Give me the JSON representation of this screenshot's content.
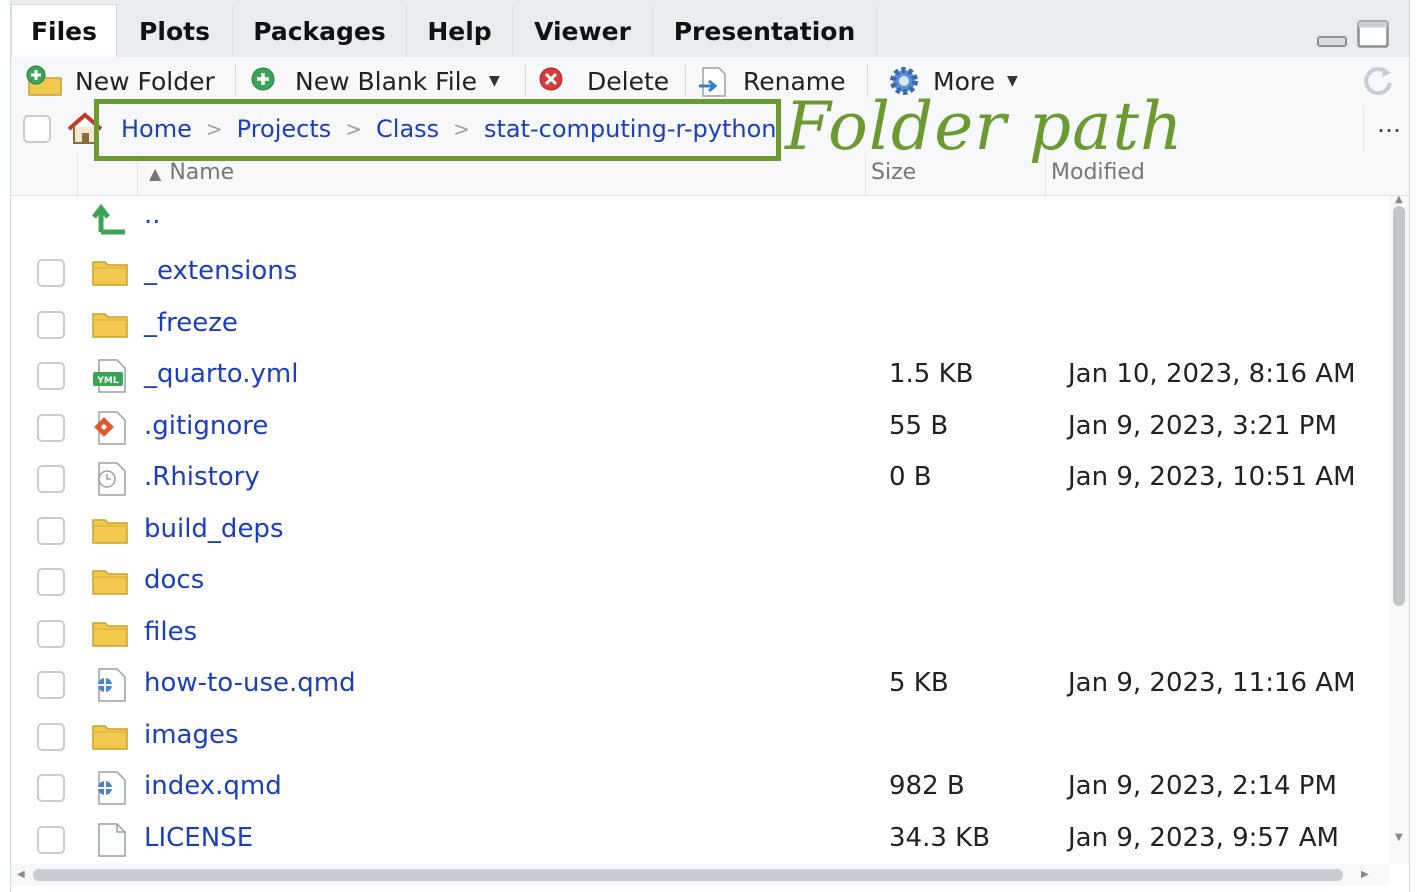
{
  "tabs": [
    {
      "label": "Files",
      "active": true
    },
    {
      "label": "Plots"
    },
    {
      "label": "Packages"
    },
    {
      "label": "Help"
    },
    {
      "label": "Viewer"
    },
    {
      "label": "Presentation"
    }
  ],
  "toolbar": {
    "new_folder": "New Folder",
    "new_blank_file": "New Blank File",
    "delete": "Delete",
    "rename": "Rename",
    "more": "More"
  },
  "breadcrumb": [
    "Home",
    "Projects",
    "Class",
    "stat-computing-r-python"
  ],
  "annotation": {
    "text": "Folder path",
    "color": "#6a9a30"
  },
  "columns": {
    "name": "Name",
    "size": "Size",
    "modified": "Modified",
    "sort_indicator": "▲"
  },
  "parent_dir": "..",
  "files": [
    {
      "name": "_extensions",
      "type": "folder",
      "size": "",
      "modified": ""
    },
    {
      "name": "_freeze",
      "type": "folder",
      "size": "",
      "modified": ""
    },
    {
      "name": "_quarto.yml",
      "type": "yml",
      "size": "1.5 KB",
      "modified": "Jan 10, 2023, 8:16 AM"
    },
    {
      "name": ".gitignore",
      "type": "git",
      "size": "55 B",
      "modified": "Jan 9, 2023, 3:21 PM"
    },
    {
      "name": ".Rhistory",
      "type": "history",
      "size": "0 B",
      "modified": "Jan 9, 2023, 10:51 AM"
    },
    {
      "name": "build_deps",
      "type": "folder",
      "size": "",
      "modified": ""
    },
    {
      "name": "docs",
      "type": "folder",
      "size": "",
      "modified": ""
    },
    {
      "name": "files",
      "type": "folder",
      "size": "",
      "modified": ""
    },
    {
      "name": "how-to-use.qmd",
      "type": "qmd",
      "size": "5 KB",
      "modified": "Jan 9, 2023, 11:16 AM"
    },
    {
      "name": "images",
      "type": "folder",
      "size": "",
      "modified": ""
    },
    {
      "name": "index.qmd",
      "type": "qmd",
      "size": "982 B",
      "modified": "Jan 9, 2023, 2:14 PM"
    },
    {
      "name": "LICENSE",
      "type": "text",
      "size": "34.3 KB",
      "modified": "Jan 9, 2023, 9:57 AM"
    }
  ],
  "colors": {
    "link": "#1b3fbf",
    "highlight": "#6a9a30",
    "folder": "#f2c94c"
  }
}
